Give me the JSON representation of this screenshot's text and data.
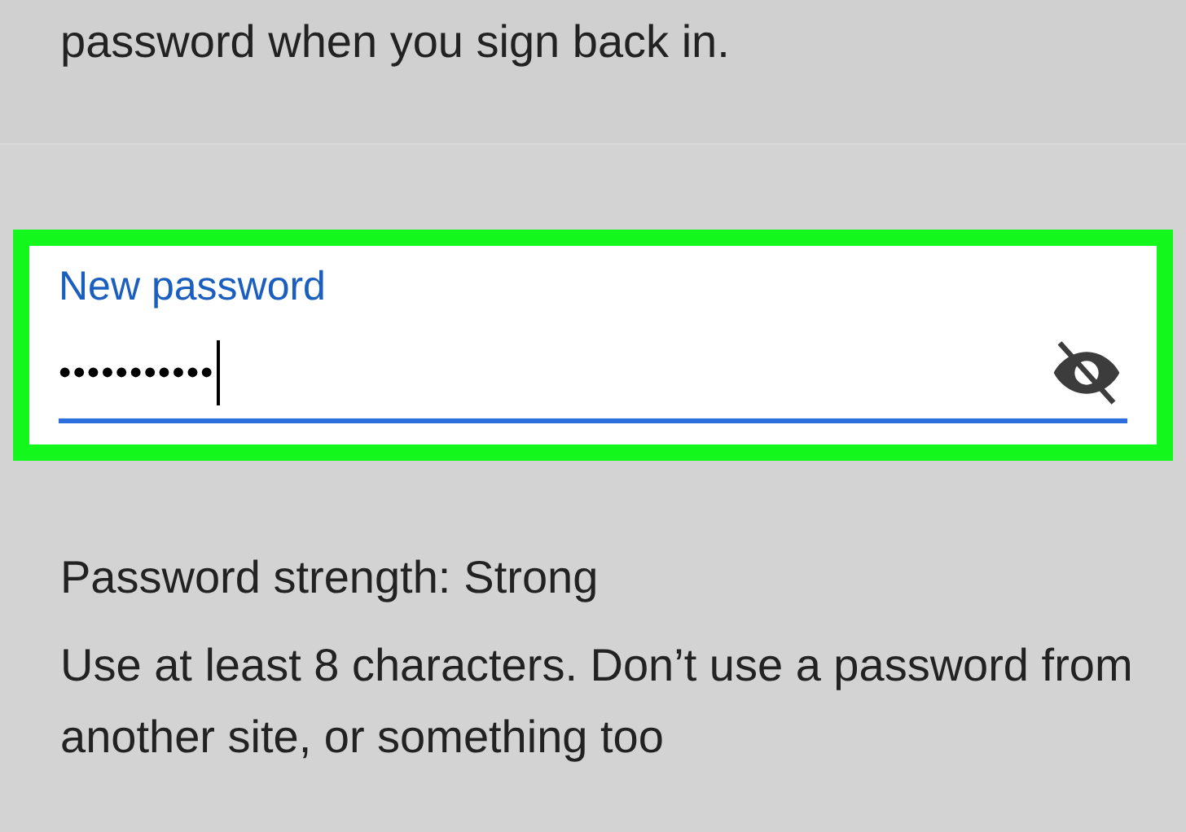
{
  "intro_text": "password when you sign back in.",
  "password_field": {
    "label": "New password",
    "value": "•••••••••••",
    "focused": true,
    "highlighted": true,
    "password_visible": false
  },
  "strength": {
    "label": "Password strength:",
    "value": "Strong"
  },
  "hint_text": "Use at least 8 characters. Don’t use a password from another site, or something too"
}
